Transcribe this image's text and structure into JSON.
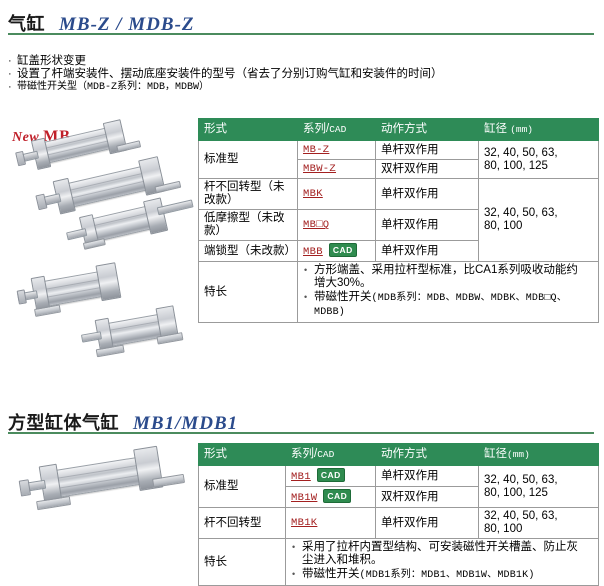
{
  "section1": {
    "title_cn": "气缸",
    "title_en": "MB-Z / MDB-Z",
    "bullets": [
      "缸盖形状变更",
      "设置了杆端安装件、摆动底座安装件的型号（省去了分别订购气缸和安装件的时间）",
      "带磁性开关型（MDB-Z系列：MDB，MDBW）"
    ],
    "photo_label_new": "New",
    "photo_label_mb": "MB",
    "table": {
      "headers": [
        "形式",
        "系列/CAD",
        "动作方式",
        "缸径（mm）"
      ],
      "header_bore_label": "缸径",
      "header_bore_unit": "(mm)",
      "header_series_main": "系列/",
      "header_series_cad": "CAD",
      "rows": [
        {
          "type": "标准型",
          "type_rowspan": 2,
          "series": "MB-Z",
          "cad": false,
          "action": "单杆双作用",
          "bore": "32, 40, 50, 63,\n80, 100, 125",
          "bore_rowspan": 2
        },
        {
          "type": "",
          "series": "MBW-Z",
          "cad": false,
          "action": "双杆双作用",
          "bore": ""
        },
        {
          "type": "杆不回转型（未改款）",
          "series": "MBK",
          "cad": false,
          "action": "单杆双作用",
          "bore": "32, 40, 50, 63,\n80, 100",
          "bore_rowspan": 3
        },
        {
          "type": "低摩擦型（未改款）",
          "series": "MB□Q",
          "cad": false,
          "action": "单杆双作用",
          "bore": ""
        },
        {
          "type": "端锁型（未改款）",
          "series": "MBB",
          "cad": true,
          "cad_label": "CAD",
          "action": "单杆双作用",
          "bore": ""
        }
      ],
      "features_label": "特长",
      "features": [
        "方形端盖、采用拉杆型标准，比CA1系列吸收动能约增大30%。",
        "带磁性开关（MDB系列：MDB、MDBW、MDBK、MDB□Q、MDBB）"
      ],
      "feature1_part1": "方形端盖、采用拉杆型标准，比CA1系列吸收动能约",
      "feature1_part2": "增大30%。",
      "feature2_part1": "带磁性开关",
      "feature2_mono1": "(MDB系列：MDB、MDBW、MDBK、MDB□Q、",
      "feature2_mono2": "MDBB)"
    }
  },
  "section2": {
    "title_cn": "方型缸体气缸",
    "title_en": "MB1/MDB1",
    "table": {
      "headers": [
        "形式",
        "系列/CAD",
        "动作方式",
        "缸径（mm）"
      ],
      "header_bore_label": "缸径",
      "header_bore_unit": "(mm)",
      "header_series_main": "系列/",
      "header_series_cad": "CAD",
      "rows": [
        {
          "type": "标准型",
          "series": "MB1",
          "cad": true,
          "cad_label": "CAD",
          "action": "单杆双作用",
          "bore": "32, 40, 50, 63,\n80, 100, 125"
        },
        {
          "type": "",
          "series": "MB1W",
          "cad": true,
          "cad_label": "CAD",
          "action": "双杆双作用",
          "bore": ""
        },
        {
          "type": "杆不回转型",
          "series": "MB1K",
          "cad": false,
          "action": "单杆双作用",
          "bore": "32, 40, 50, 63,\n80, 100"
        }
      ],
      "features_label": "特长",
      "feature1_part1": "采用了拉杆内置型结构、可安装磁性开关槽盖、防止灰",
      "feature1_part2": "尘进入和堆积。",
      "feature2_part1": "带磁性开关",
      "feature2_mono1": "(MDB1系列：MDB1、MDB1W、MDB1K)"
    }
  },
  "colors": {
    "header_green": "#2e8b57",
    "rule_green": "#4b8b5e",
    "link_red": "#a32020",
    "title_blue": "#2b4b8c",
    "new_red": "#c0202a",
    "cad_green": "#2f8b4f"
  }
}
